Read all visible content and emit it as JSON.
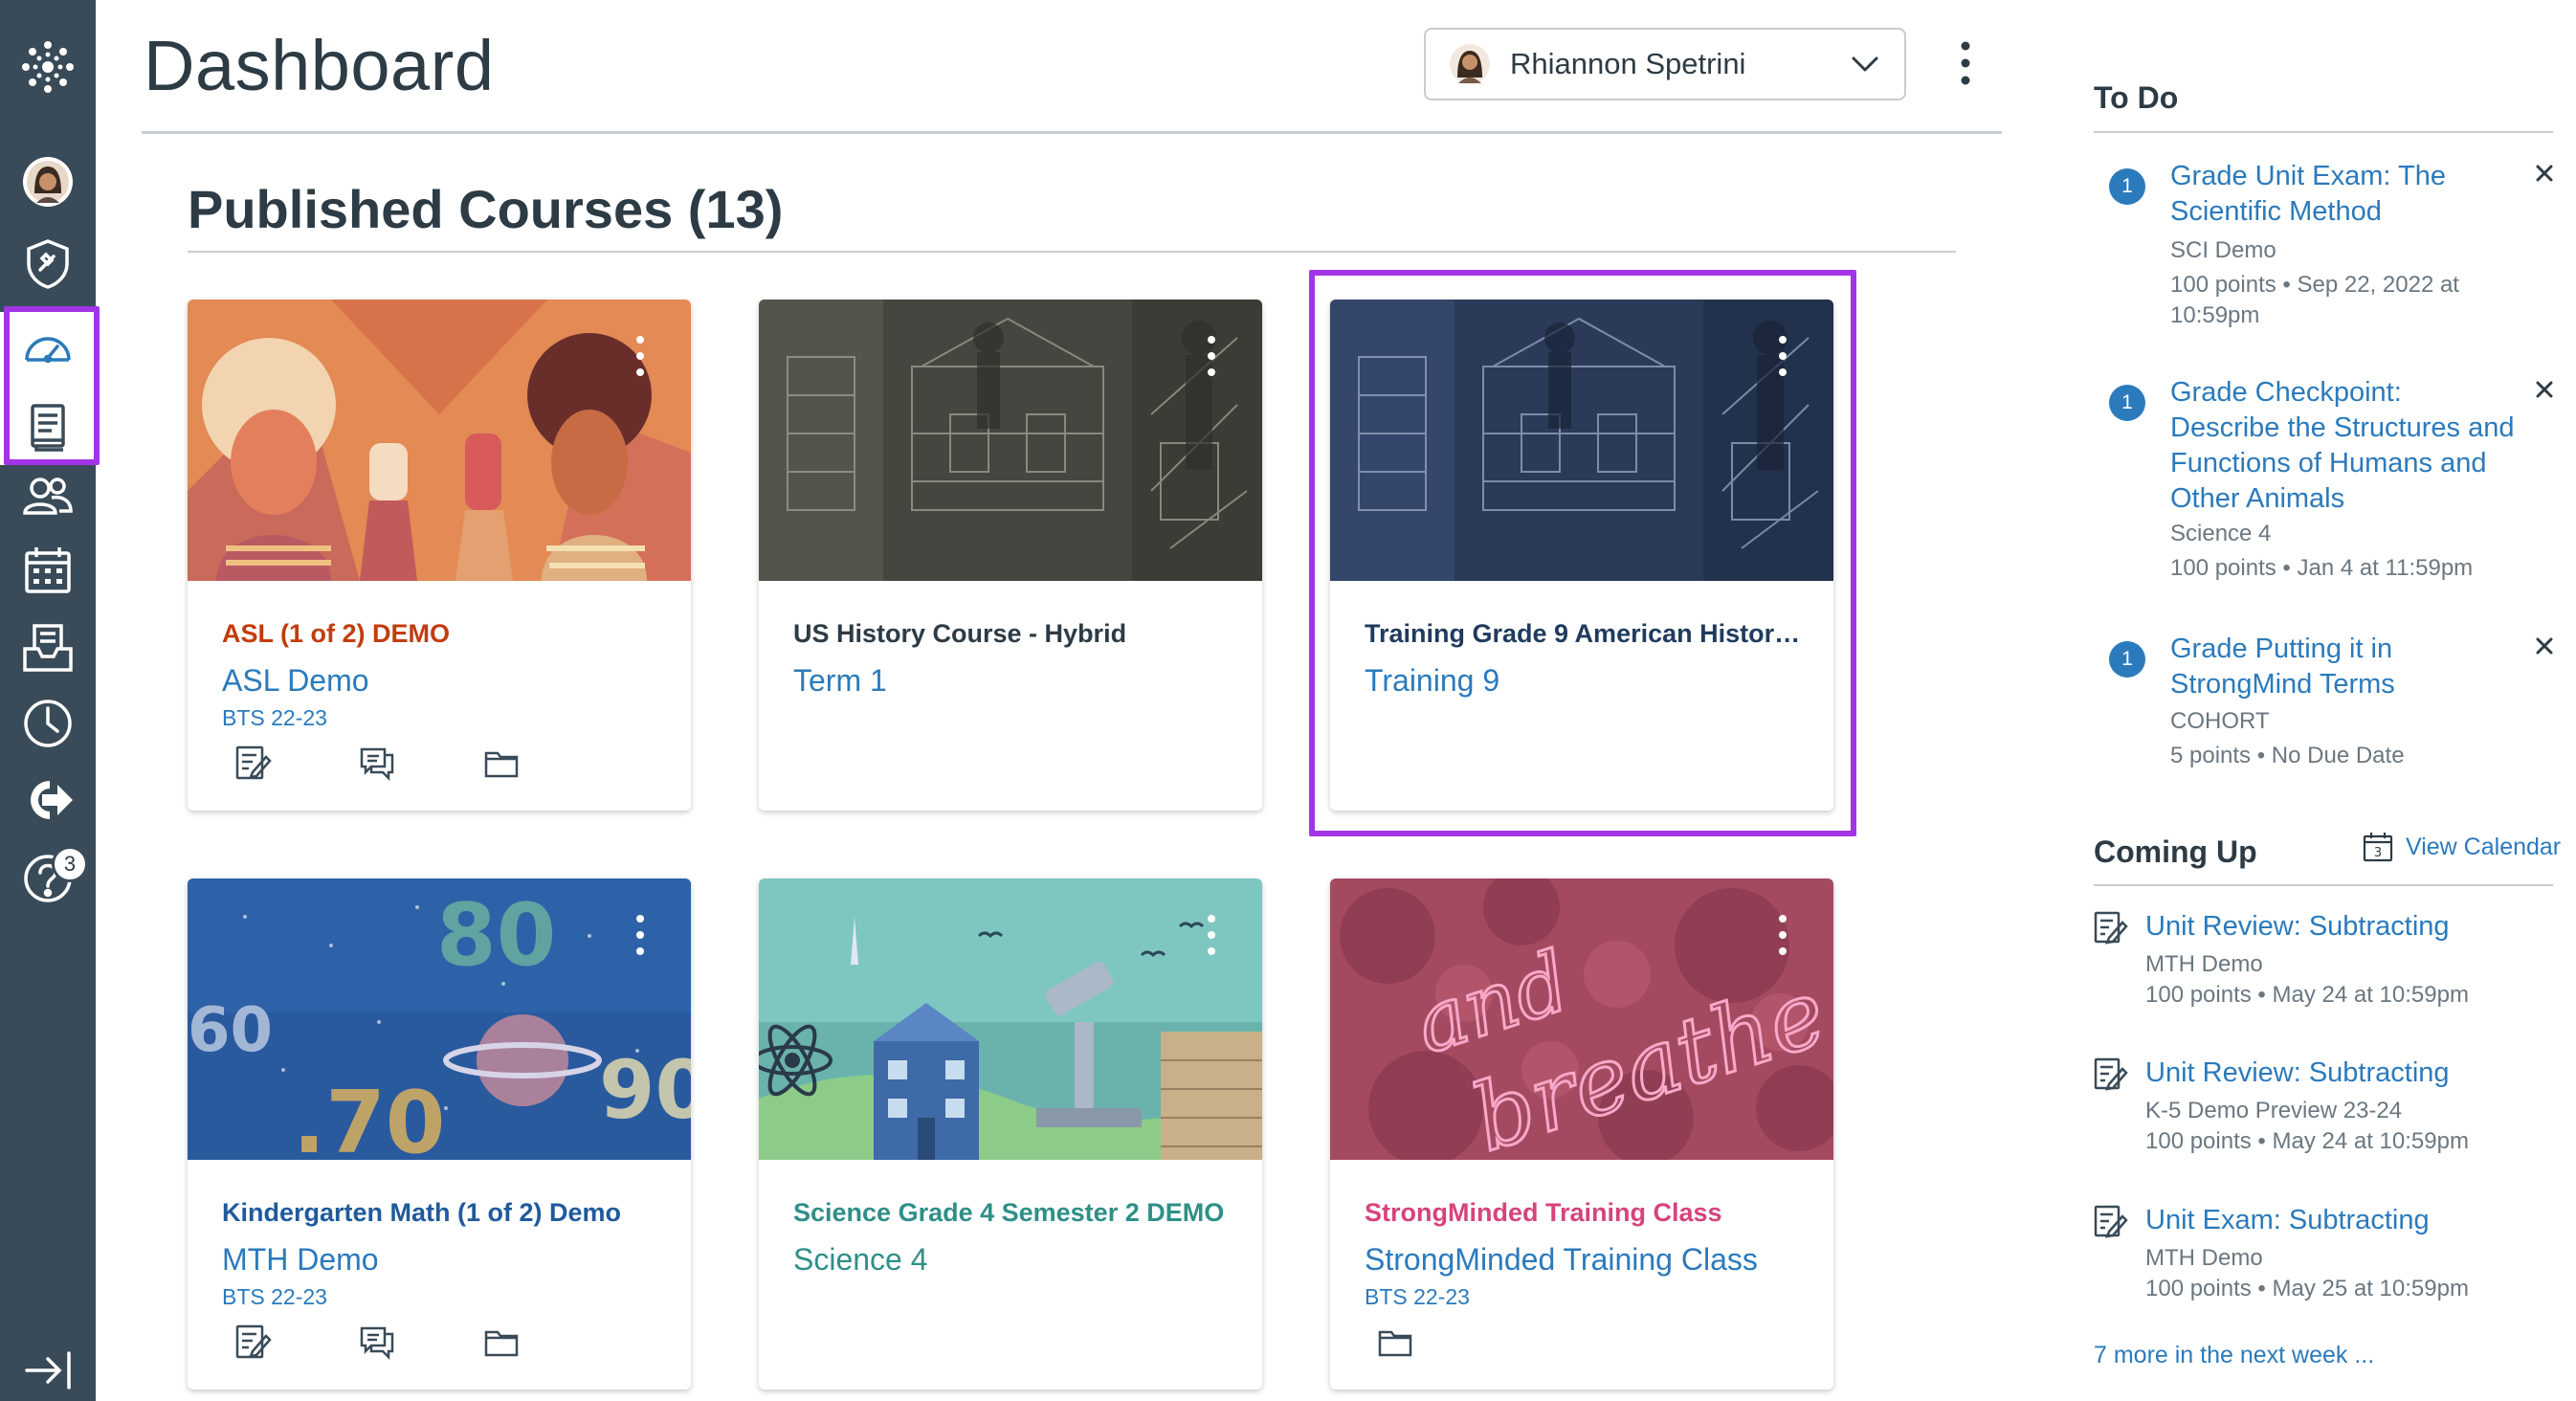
{
  "header": {
    "title": "Dashboard",
    "user_name": "Rhiannon Spetrini"
  },
  "courses": {
    "heading": "Published Courses (13)",
    "cards": [
      {
        "label": "ASL (1 of 2) DEMO",
        "name": "ASL Demo",
        "term": "BTS 22-23",
        "label_color": "#c23c0d",
        "hero": "asl"
      },
      {
        "label": "US History Course - Hybrid",
        "name": "Term 1",
        "term": "",
        "label_color": "#2d3b45",
        "hero": "history-gray"
      },
      {
        "label": "Training Grade 9 American History...",
        "name": "Training 9",
        "term": "",
        "label_color": "#1f3b5e",
        "hero": "history-blue"
      },
      {
        "label": "Kindergarten Math (1 of 2) Demo",
        "name": "MTH Demo",
        "term": "BTS 22-23",
        "label_color": "#1f5a9c",
        "hero": "math"
      },
      {
        "label": "Science Grade 4 Semester 2 DEMO",
        "name": "Science 4",
        "term": "",
        "label_color": "#2f8f87",
        "hero": "science"
      },
      {
        "label": "StrongMinded Training Class",
        "name": "StrongMinded Training Class",
        "term": "BTS 22-23",
        "label_color": "#d6437d",
        "hero": "breathe"
      }
    ]
  },
  "todo": {
    "title": "To Do",
    "items": [
      {
        "badge": "1",
        "title": "Grade Unit Exam: The Scientific Method",
        "course": "SCI Demo",
        "detail": "100 points • Sep 22, 2022 at 10:59pm"
      },
      {
        "badge": "1",
        "title": "Grade Checkpoint: Describe the Structures and Functions of Humans and Other Animals",
        "course": "Science 4",
        "detail": "100 points • Jan 4 at 11:59pm"
      },
      {
        "badge": "1",
        "title": "Grade Putting it in StrongMind Terms",
        "course": "COHORT",
        "detail": "5 points • No Due Date"
      }
    ]
  },
  "coming_up": {
    "title": "Coming Up",
    "view_calendar": "View Calendar",
    "calendar_day": "3",
    "items": [
      {
        "title": "Unit Review: Subtracting",
        "course": "MTH Demo",
        "detail": "100 points • May 24 at 10:59pm"
      },
      {
        "title": "Unit Review: Subtracting",
        "course": "K-5 Demo Preview 23-24",
        "detail": "100 points • May 24 at 10:59pm"
      },
      {
        "title": "Unit Exam: Subtracting",
        "course": "MTH Demo",
        "detail": "100 points • May 25 at 10:59pm"
      }
    ],
    "more": "7 more in the next week ..."
  },
  "nav": {
    "help_badge": "3",
    "items": [
      "logo",
      "account",
      "admin",
      "dashboard",
      "courses",
      "groups",
      "calendar",
      "inbox",
      "history",
      "commons",
      "help"
    ]
  },
  "colors": {
    "nav_bg": "#394b58",
    "highlight": "#a134e6",
    "link": "#2b7abc"
  }
}
